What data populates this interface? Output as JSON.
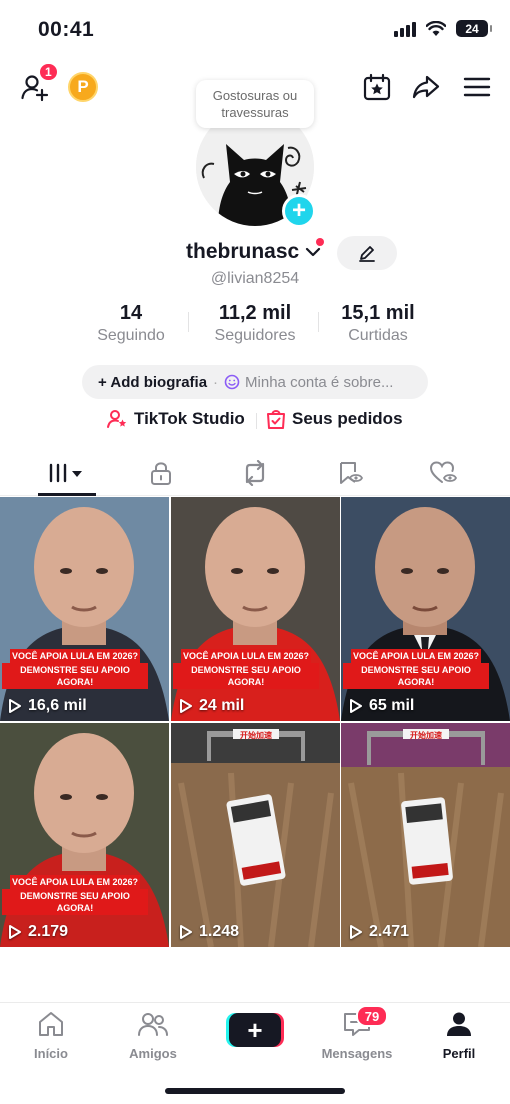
{
  "status_bar": {
    "time": "00:41",
    "battery": "24"
  },
  "top_nav": {
    "notification_count": "1",
    "coin_label": "P"
  },
  "tooltip": {
    "line1": "Gostosuras ou",
    "line2": "travessuras"
  },
  "profile": {
    "display_name": "thebrunasc",
    "handle": "@livian8254"
  },
  "stats": [
    {
      "value": "14",
      "label": "Seguindo"
    },
    {
      "value": "11,2 mil",
      "label": "Seguidores"
    },
    {
      "value": "15,1 mil",
      "label": "Curtidas"
    }
  ],
  "bio": {
    "add_label": "+ Add biografia",
    "sep": "·",
    "hint": "Minha conta é sobre..."
  },
  "links": {
    "studio": "TikTok Studio",
    "orders": "Seus pedidos"
  },
  "videos": [
    {
      "caption_line1": "VOCÊ APOIA LULA EM 2026?",
      "caption_line2": "DEMONSTRE SEU APOIO AGORA!",
      "views": "16,6 mil",
      "shirt": "#2b2f3a",
      "bg": "#6f8aa3"
    },
    {
      "caption_line1": "VOCÊ APOIA LULA EM 2026?",
      "caption_line2": "DEMONSTRE SEU APOIO AGORA!",
      "views": "24 mil",
      "shirt": "#d8201c",
      "bg": "#4f4a44"
    },
    {
      "caption_line1": "VOCÊ APOIA LULA EM 2026?",
      "caption_line2": "DEMONSTRE SEU APOIO AGORA!",
      "views": "65 mil",
      "shirt": "#15171c",
      "bg": "#3c4d63"
    },
    {
      "caption_line1": "VOCÊ APOIA LULA EM 2026?",
      "caption_line2": "DEMONSTRE SEU APOIO AGORA!",
      "views": "2.179",
      "shirt": "#c8201d",
      "bg": "#4b4f3e"
    },
    {
      "caption_line1": "",
      "caption_line2": "",
      "views": "1.248",
      "sign": "开始加速"
    },
    {
      "caption_line1": "",
      "caption_line2": "",
      "views": "2.471",
      "sign": "开始加速"
    }
  ],
  "bottom_nav": [
    {
      "label": "Início",
      "icon": "home-icon"
    },
    {
      "label": "Amigos",
      "icon": "friends-icon"
    },
    {
      "label": "",
      "icon": "plus-icon"
    },
    {
      "label": "Mensagens",
      "icon": "inbox-icon",
      "badge": "79"
    },
    {
      "label": "Perfil",
      "icon": "profile-icon"
    }
  ]
}
